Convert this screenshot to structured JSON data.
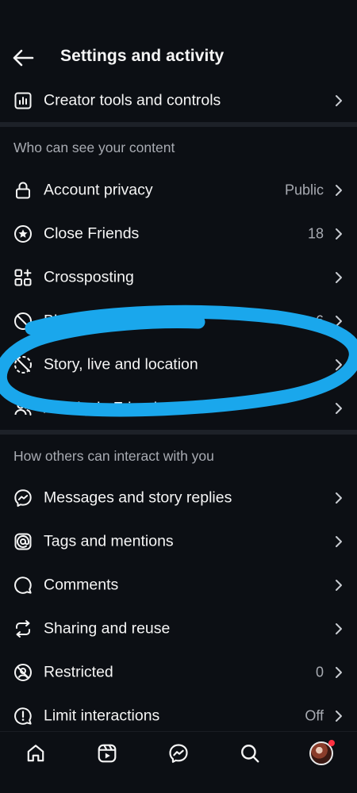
{
  "header": {
    "title": "Settings and activity",
    "back_icon": "arrow-left-icon"
  },
  "rows_top": [
    {
      "label": "Creator tools and controls",
      "icon": "chart-bar-icon",
      "value": ""
    }
  ],
  "sections": [
    {
      "title": "Who can see your content",
      "items": [
        {
          "label": "Account privacy",
          "icon": "lock-icon",
          "value": "Public"
        },
        {
          "label": "Close Friends",
          "icon": "star-circle-icon",
          "value": "18"
        },
        {
          "label": "Crossposting",
          "icon": "grid-plus-icon",
          "value": ""
        },
        {
          "label": "Blo",
          "icon": "blocked-icon",
          "value": "6"
        },
        {
          "label": "Story, live and location",
          "icon": "story-off-icon",
          "value": ""
        },
        {
          "label": "Activity in Friends",
          "icon": "users-icon",
          "value": ""
        }
      ]
    },
    {
      "title": "How others can interact with you",
      "items": [
        {
          "label": "Messages and story replies",
          "icon": "messenger-icon",
          "value": ""
        },
        {
          "label": "Tags and mentions",
          "icon": "at-sign-icon",
          "value": ""
        },
        {
          "label": "Comments",
          "icon": "comment-icon",
          "value": ""
        },
        {
          "label": "Sharing and reuse",
          "icon": "share-reuse-icon",
          "value": ""
        },
        {
          "label": "Restricted",
          "icon": "restricted-icon",
          "value": "0"
        },
        {
          "label": "Limit interactions",
          "icon": "limit-icon",
          "value": "Off"
        }
      ]
    }
  ],
  "bottom_nav": [
    {
      "name": "home",
      "icon": "home-icon"
    },
    {
      "name": "reels",
      "icon": "reels-icon"
    },
    {
      "name": "messenger",
      "icon": "messenger-icon"
    },
    {
      "name": "search",
      "icon": "search-icon"
    },
    {
      "name": "profile",
      "icon": "avatar"
    }
  ],
  "colors": {
    "background": "#0c0f14",
    "text": "#f5f5f5",
    "muted": "#a8abb2",
    "annotation": "#1aa7ec",
    "notification": "#ff3040"
  }
}
